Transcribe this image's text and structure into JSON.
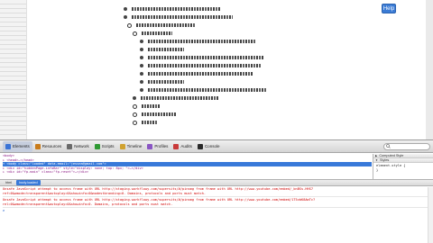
{
  "page": {
    "help_label": "Help"
  },
  "devtools": {
    "tabs": [
      {
        "label": "Elements",
        "color": "#3b74d6"
      },
      {
        "label": "Resources",
        "color": "#c97b1a"
      },
      {
        "label": "Network",
        "color": "#6a6a6a"
      },
      {
        "label": "Scripts",
        "color": "#2f9a33"
      },
      {
        "label": "Timeline",
        "color": "#d0a230"
      },
      {
        "label": "Profiles",
        "color": "#8a56c4"
      },
      {
        "label": "Audits",
        "color": "#c93a3a"
      },
      {
        "label": "Console",
        "color": "#2a2a2a"
      }
    ],
    "dom_lines": [
      "<body>",
      "  ▸ <head>…</head>",
      "  ▾ <body class=\"loaded\" data-email=\"jessea@gmail.com\">",
      "    ▸ <div id=\"hiddenPage-infoBar\" style=\"display: none; top: 8px; \">…</div>",
      "    ▸ <div id=\"fp-main\" class=\"fp-reset\">…</div>"
    ],
    "styles": {
      "computed_label": "Computed Style",
      "styles_label": "Styles",
      "rule_selector": "element.style {",
      "rule_close": "}"
    },
    "crumbs": [
      "html",
      "body.loaded"
    ],
    "console_lines": [
      "Unsafe JavaScript attempt to access frame with URL http://staging.workflowy.com/supersits/#/pinsmg from frame with URL http://www.youtube.com/embed/_bnBSs-HHS7",
      "ref=0&wmode=transparent&autoplay=0&showinfo=0&modestbranding=0. Domains, protocols and ports must match.",
      "Unsafe JavaScript attempt to access frame with URL http://staging.workflowy.com/supersits/#/pinsmg from frame with URL http://www.youtube.com/embed/1T5vbK8AmTc?",
      "rel=0&wmode=transparent&autoplay=0&showinfo=0. Domains, protocols and ports must match."
    ],
    "prompt": ">"
  }
}
